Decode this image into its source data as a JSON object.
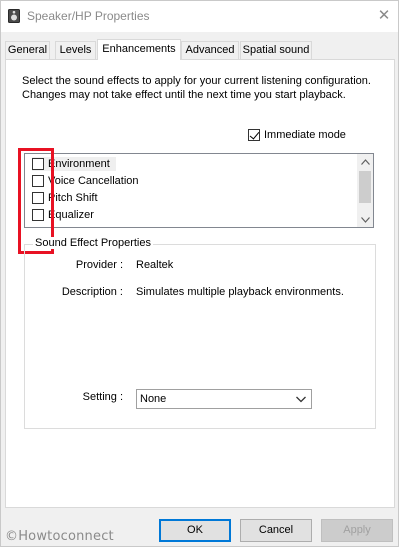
{
  "window": {
    "title": "Speaker/HP Properties",
    "close_glyph": "✕"
  },
  "tabs": [
    {
      "label": "General",
      "active": false
    },
    {
      "label": "Levels",
      "active": false
    },
    {
      "label": "Enhancements",
      "active": true
    },
    {
      "label": "Advanced",
      "active": false
    },
    {
      "label": "Spatial sound",
      "active": false
    }
  ],
  "enhancements": {
    "description": "Select the sound effects to apply for your current listening configuration. Changes may not take effect until the next time you start playback.",
    "immediate_mode_label": "Immediate mode",
    "immediate_mode_checked": true,
    "effects": [
      {
        "label": "Environment",
        "checked": false
      },
      {
        "label": "Voice Cancellation",
        "checked": false
      },
      {
        "label": "Pitch Shift",
        "checked": false
      },
      {
        "label": "Equalizer",
        "checked": false
      }
    ],
    "highlight_color": "#e81123"
  },
  "sound_effect_properties": {
    "title": "Sound Effect Properties",
    "provider_label": "Provider :",
    "provider_value": "Realtek",
    "description_label": "Description :",
    "description_value": "Simulates multiple playback environments.",
    "setting_label": "Setting :",
    "setting_value": "None"
  },
  "buttons": {
    "ok": "OK",
    "cancel": "Cancel",
    "apply": "Apply"
  },
  "watermark": "©Howtoconnect",
  "colors": {
    "accent": "#0078d7",
    "dialog_bg": "#f0f0f0",
    "panel_bg": "#ffffff"
  }
}
